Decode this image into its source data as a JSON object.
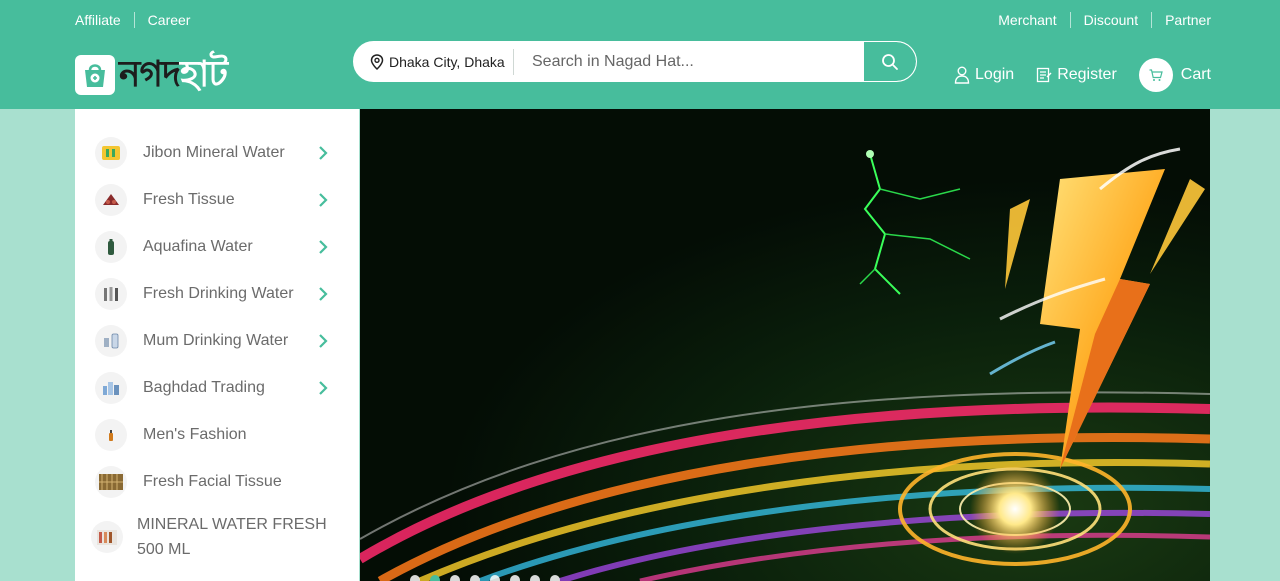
{
  "topbar": {
    "left_links": [
      "Affiliate",
      "Career"
    ],
    "right_links": [
      "Merchant",
      "Discount",
      "Partner"
    ]
  },
  "logo": {
    "dark_part": "নগদ",
    "light_part": "হাট"
  },
  "search": {
    "location": "Dhaka City, Dhaka",
    "placeholder": "Search in Nagad Hat...",
    "value": ""
  },
  "actions": {
    "login": "Login",
    "register": "Register",
    "cart": "Cart"
  },
  "categories": [
    {
      "label": "Jibon Mineral Water",
      "has_submenu": true
    },
    {
      "label": "Fresh Tissue",
      "has_submenu": true
    },
    {
      "label": "Aquafina Water",
      "has_submenu": true
    },
    {
      "label": "Fresh Drinking Water",
      "has_submenu": true
    },
    {
      "label": "Mum Drinking Water",
      "has_submenu": true
    },
    {
      "label": "Baghdad Trading",
      "has_submenu": true
    },
    {
      "label": "Men's Fashion",
      "has_submenu": false
    },
    {
      "label": "Fresh Facial Tissue",
      "has_submenu": false
    },
    {
      "label": "MINERAL WATER FRESH 500 ML",
      "has_submenu": false
    }
  ],
  "banner": {
    "slide_count": 8,
    "active_slide": 1
  },
  "colors": {
    "brand": "#47bd9c",
    "page_bg": "#a8e0cf",
    "banner_bg": "#071a08"
  }
}
